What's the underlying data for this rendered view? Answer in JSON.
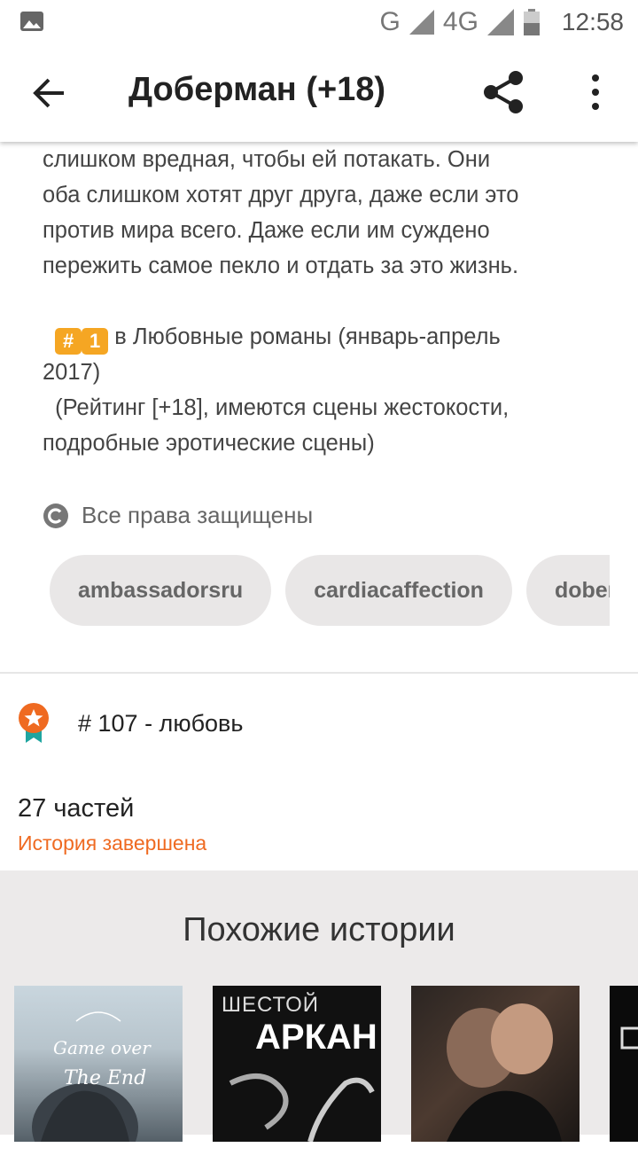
{
  "status_bar": {
    "network_g": "G",
    "network_4g": "4G",
    "time": "12:58"
  },
  "app_bar": {
    "title": "Доберман (+18)"
  },
  "description": {
    "line1": "слишком вредная, чтобы ей потакать. Они",
    "line2": "оба слишком хотят друг друга, даже если это",
    "line3": "против мира всего. Даже если им суждено",
    "line4": "пережить самое пекло и отдать за это жизнь.",
    "badge_hash": "#",
    "badge_one": "1",
    "rank_line_a": " в Любовные романы (январь-апрель",
    "rank_line_b": "2017)",
    "rating_line_a": "  (Рейтинг [+18], имеются сцены жестокости,",
    "rating_line_b": "подробные эротические сцены)"
  },
  "copyright": {
    "text": "Все права защищены"
  },
  "tags": [
    "ambassadorsru",
    "cardiacaffection",
    "doberman"
  ],
  "ranking": {
    "text": "# 107 - любовь"
  },
  "parts": {
    "count_text": "27 частей",
    "status_text": "История завершена"
  },
  "similar": {
    "title": "Похожие истории",
    "covers": [
      {
        "line1": "Game over",
        "line2": "The End"
      },
      {
        "line1": "ШЕСТОЙ",
        "line2": "АРКАН"
      },
      {},
      {}
    ]
  },
  "colors": {
    "accent_orange": "#ef6a21",
    "tag_bg": "#e9e7e7",
    "similar_bg": "#eceaea"
  }
}
